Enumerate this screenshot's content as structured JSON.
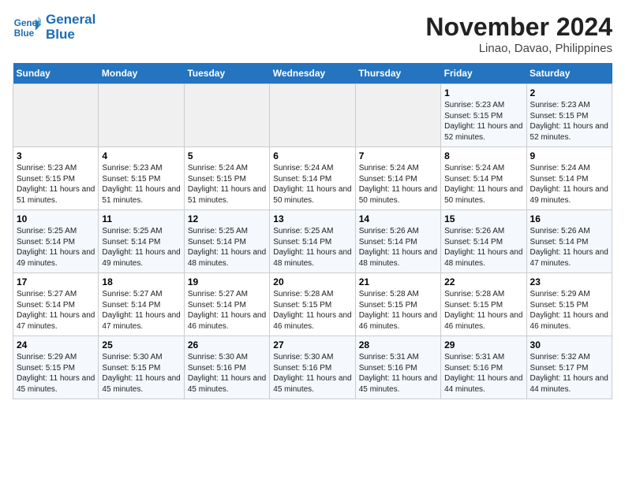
{
  "header": {
    "logo_line1": "General",
    "logo_line2": "Blue",
    "title": "November 2024",
    "subtitle": "Linao, Davao, Philippines"
  },
  "weekdays": [
    "Sunday",
    "Monday",
    "Tuesday",
    "Wednesday",
    "Thursday",
    "Friday",
    "Saturday"
  ],
  "weeks": [
    [
      {
        "day": "",
        "info": ""
      },
      {
        "day": "",
        "info": ""
      },
      {
        "day": "",
        "info": ""
      },
      {
        "day": "",
        "info": ""
      },
      {
        "day": "",
        "info": ""
      },
      {
        "day": "1",
        "info": "Sunrise: 5:23 AM\nSunset: 5:15 PM\nDaylight: 11 hours and 52 minutes."
      },
      {
        "day": "2",
        "info": "Sunrise: 5:23 AM\nSunset: 5:15 PM\nDaylight: 11 hours and 52 minutes."
      }
    ],
    [
      {
        "day": "3",
        "info": "Sunrise: 5:23 AM\nSunset: 5:15 PM\nDaylight: 11 hours and 51 minutes."
      },
      {
        "day": "4",
        "info": "Sunrise: 5:23 AM\nSunset: 5:15 PM\nDaylight: 11 hours and 51 minutes."
      },
      {
        "day": "5",
        "info": "Sunrise: 5:24 AM\nSunset: 5:15 PM\nDaylight: 11 hours and 51 minutes."
      },
      {
        "day": "6",
        "info": "Sunrise: 5:24 AM\nSunset: 5:14 PM\nDaylight: 11 hours and 50 minutes."
      },
      {
        "day": "7",
        "info": "Sunrise: 5:24 AM\nSunset: 5:14 PM\nDaylight: 11 hours and 50 minutes."
      },
      {
        "day": "8",
        "info": "Sunrise: 5:24 AM\nSunset: 5:14 PM\nDaylight: 11 hours and 50 minutes."
      },
      {
        "day": "9",
        "info": "Sunrise: 5:24 AM\nSunset: 5:14 PM\nDaylight: 11 hours and 49 minutes."
      }
    ],
    [
      {
        "day": "10",
        "info": "Sunrise: 5:25 AM\nSunset: 5:14 PM\nDaylight: 11 hours and 49 minutes."
      },
      {
        "day": "11",
        "info": "Sunrise: 5:25 AM\nSunset: 5:14 PM\nDaylight: 11 hours and 49 minutes."
      },
      {
        "day": "12",
        "info": "Sunrise: 5:25 AM\nSunset: 5:14 PM\nDaylight: 11 hours and 48 minutes."
      },
      {
        "day": "13",
        "info": "Sunrise: 5:25 AM\nSunset: 5:14 PM\nDaylight: 11 hours and 48 minutes."
      },
      {
        "day": "14",
        "info": "Sunrise: 5:26 AM\nSunset: 5:14 PM\nDaylight: 11 hours and 48 minutes."
      },
      {
        "day": "15",
        "info": "Sunrise: 5:26 AM\nSunset: 5:14 PM\nDaylight: 11 hours and 48 minutes."
      },
      {
        "day": "16",
        "info": "Sunrise: 5:26 AM\nSunset: 5:14 PM\nDaylight: 11 hours and 47 minutes."
      }
    ],
    [
      {
        "day": "17",
        "info": "Sunrise: 5:27 AM\nSunset: 5:14 PM\nDaylight: 11 hours and 47 minutes."
      },
      {
        "day": "18",
        "info": "Sunrise: 5:27 AM\nSunset: 5:14 PM\nDaylight: 11 hours and 47 minutes."
      },
      {
        "day": "19",
        "info": "Sunrise: 5:27 AM\nSunset: 5:14 PM\nDaylight: 11 hours and 46 minutes."
      },
      {
        "day": "20",
        "info": "Sunrise: 5:28 AM\nSunset: 5:15 PM\nDaylight: 11 hours and 46 minutes."
      },
      {
        "day": "21",
        "info": "Sunrise: 5:28 AM\nSunset: 5:15 PM\nDaylight: 11 hours and 46 minutes."
      },
      {
        "day": "22",
        "info": "Sunrise: 5:28 AM\nSunset: 5:15 PM\nDaylight: 11 hours and 46 minutes."
      },
      {
        "day": "23",
        "info": "Sunrise: 5:29 AM\nSunset: 5:15 PM\nDaylight: 11 hours and 46 minutes."
      }
    ],
    [
      {
        "day": "24",
        "info": "Sunrise: 5:29 AM\nSunset: 5:15 PM\nDaylight: 11 hours and 45 minutes."
      },
      {
        "day": "25",
        "info": "Sunrise: 5:30 AM\nSunset: 5:15 PM\nDaylight: 11 hours and 45 minutes."
      },
      {
        "day": "26",
        "info": "Sunrise: 5:30 AM\nSunset: 5:16 PM\nDaylight: 11 hours and 45 minutes."
      },
      {
        "day": "27",
        "info": "Sunrise: 5:30 AM\nSunset: 5:16 PM\nDaylight: 11 hours and 45 minutes."
      },
      {
        "day": "28",
        "info": "Sunrise: 5:31 AM\nSunset: 5:16 PM\nDaylight: 11 hours and 45 minutes."
      },
      {
        "day": "29",
        "info": "Sunrise: 5:31 AM\nSunset: 5:16 PM\nDaylight: 11 hours and 44 minutes."
      },
      {
        "day": "30",
        "info": "Sunrise: 5:32 AM\nSunset: 5:17 PM\nDaylight: 11 hours and 44 minutes."
      }
    ]
  ]
}
